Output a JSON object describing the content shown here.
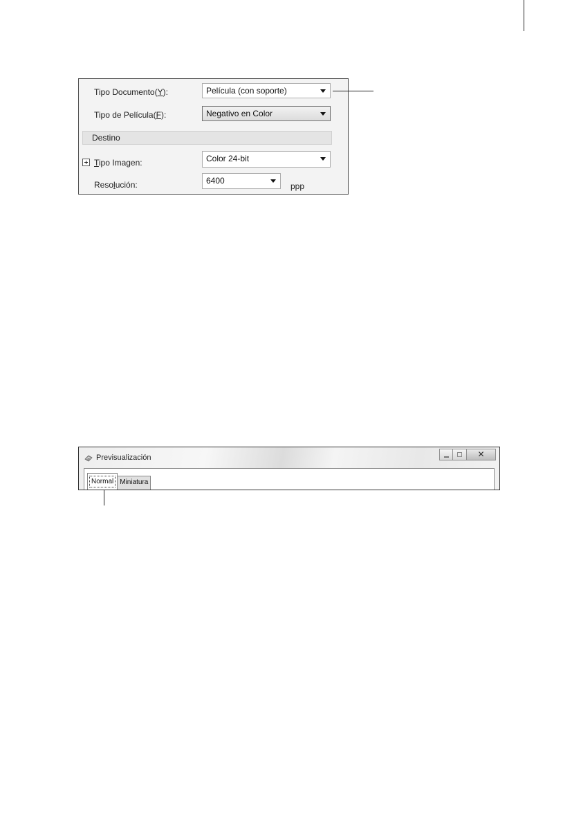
{
  "settings": {
    "document_type": {
      "label_prefix": "Tipo Documento(",
      "mnemonic": "Y",
      "label_suffix": "):",
      "value": "Película (con soporte)"
    },
    "film_type": {
      "label_prefix": "Tipo de Película(",
      "mnemonic": "F",
      "label_suffix": "):",
      "value": "Negativo en Color"
    },
    "destination_header": "Destino",
    "image_type": {
      "mnemonic": "T",
      "label_rest": "ipo Imagen:",
      "value": "Color 24-bit"
    },
    "resolution": {
      "label_prefix": "Reso",
      "mnemonic": "l",
      "label_suffix": "ución:",
      "value": "6400",
      "unit": "ppp"
    }
  },
  "preview_window": {
    "title": "Previsualización",
    "close_glyph": "✕",
    "tabs": [
      {
        "label": "Normal",
        "active": true
      },
      {
        "label": "Miniatura",
        "active": false
      }
    ]
  }
}
